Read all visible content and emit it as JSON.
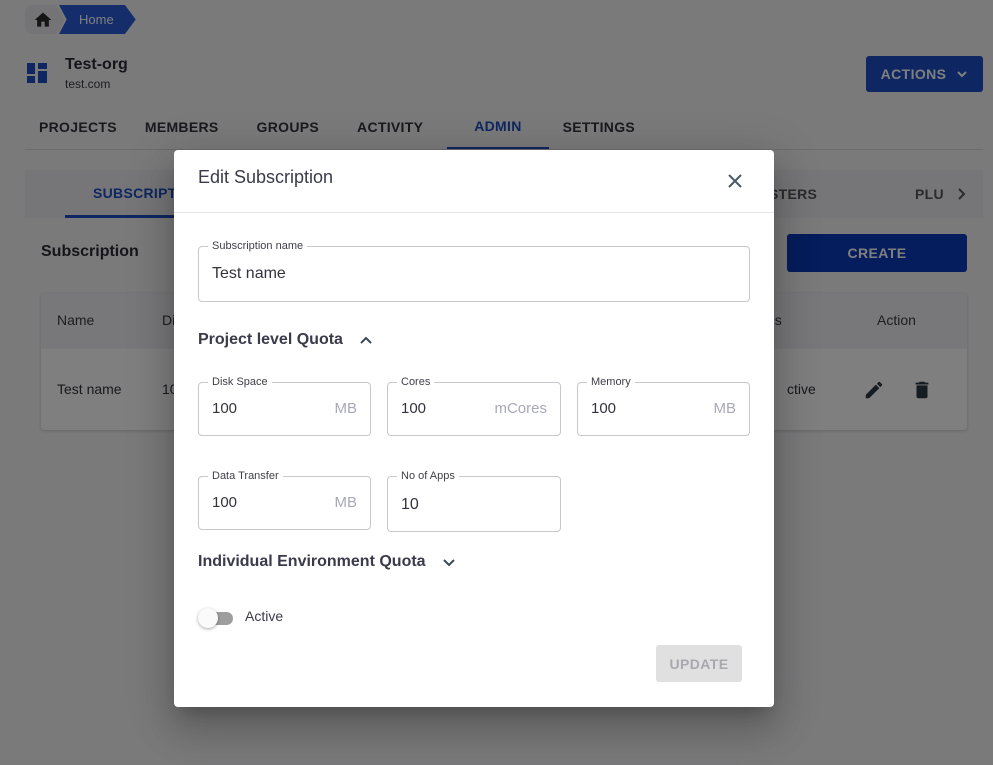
{
  "breadcrumb": {
    "home_icon": "home-icon",
    "items": [
      {
        "label": "Home"
      }
    ]
  },
  "org": {
    "icon": "dashboard-icon",
    "name": "Test-org",
    "domain": "test.com"
  },
  "header": {
    "actions_label": "ACTIONS",
    "actions_icon": "chevron-down-icon"
  },
  "main_tabs": [
    {
      "label": "PROJECTS",
      "active": false
    },
    {
      "label": "MEMBERS",
      "active": false
    },
    {
      "label": "GROUPS",
      "active": false
    },
    {
      "label": "ACTIVITY",
      "active": false
    },
    {
      "label": "ADMIN",
      "active": true
    },
    {
      "label": "SETTINGS",
      "active": false
    }
  ],
  "sub_tabs": {
    "visible": [
      {
        "label": "SUBSCRIPTI",
        "active": true
      },
      {
        "label": "STERS",
        "active": false
      },
      {
        "label": "PLU",
        "active": false
      }
    ],
    "scroll_icon": "chevron-right-icon"
  },
  "subscription_section": {
    "title": "Subscription",
    "create_label": "CREATE",
    "table": {
      "headers": [
        "Name",
        "Di",
        "us",
        "Action"
      ],
      "rows": [
        {
          "name": "Test name",
          "disk": "10",
          "status": "ctive",
          "actions": [
            "edit-icon",
            "delete-icon"
          ]
        }
      ]
    }
  },
  "modal": {
    "title": "Edit Subscription",
    "close_icon": "close-icon",
    "subscription_name": {
      "label": "Subscription name",
      "value": "Test name"
    },
    "project_quota": {
      "heading": "Project level Quota",
      "expanded": true,
      "fields": [
        {
          "label": "Disk Space",
          "value": "100",
          "suffix": "MB"
        },
        {
          "label": "Cores",
          "value": "100",
          "suffix": "mCores"
        },
        {
          "label": "Memory",
          "value": "100",
          "suffix": "MB"
        },
        {
          "label": "Data Transfer",
          "value": "100",
          "suffix": "MB"
        },
        {
          "label": "No of Apps",
          "value": "10",
          "suffix": ""
        }
      ]
    },
    "env_quota": {
      "heading": "Individual Environment Quota",
      "expanded": false
    },
    "active_toggle": {
      "label": "Active",
      "checked": false
    },
    "update_label": "UPDATE"
  },
  "colors": {
    "primary": "#1c4fc4",
    "create_button": "#0b3bb8",
    "disabled_button": "#e0e0e0"
  }
}
